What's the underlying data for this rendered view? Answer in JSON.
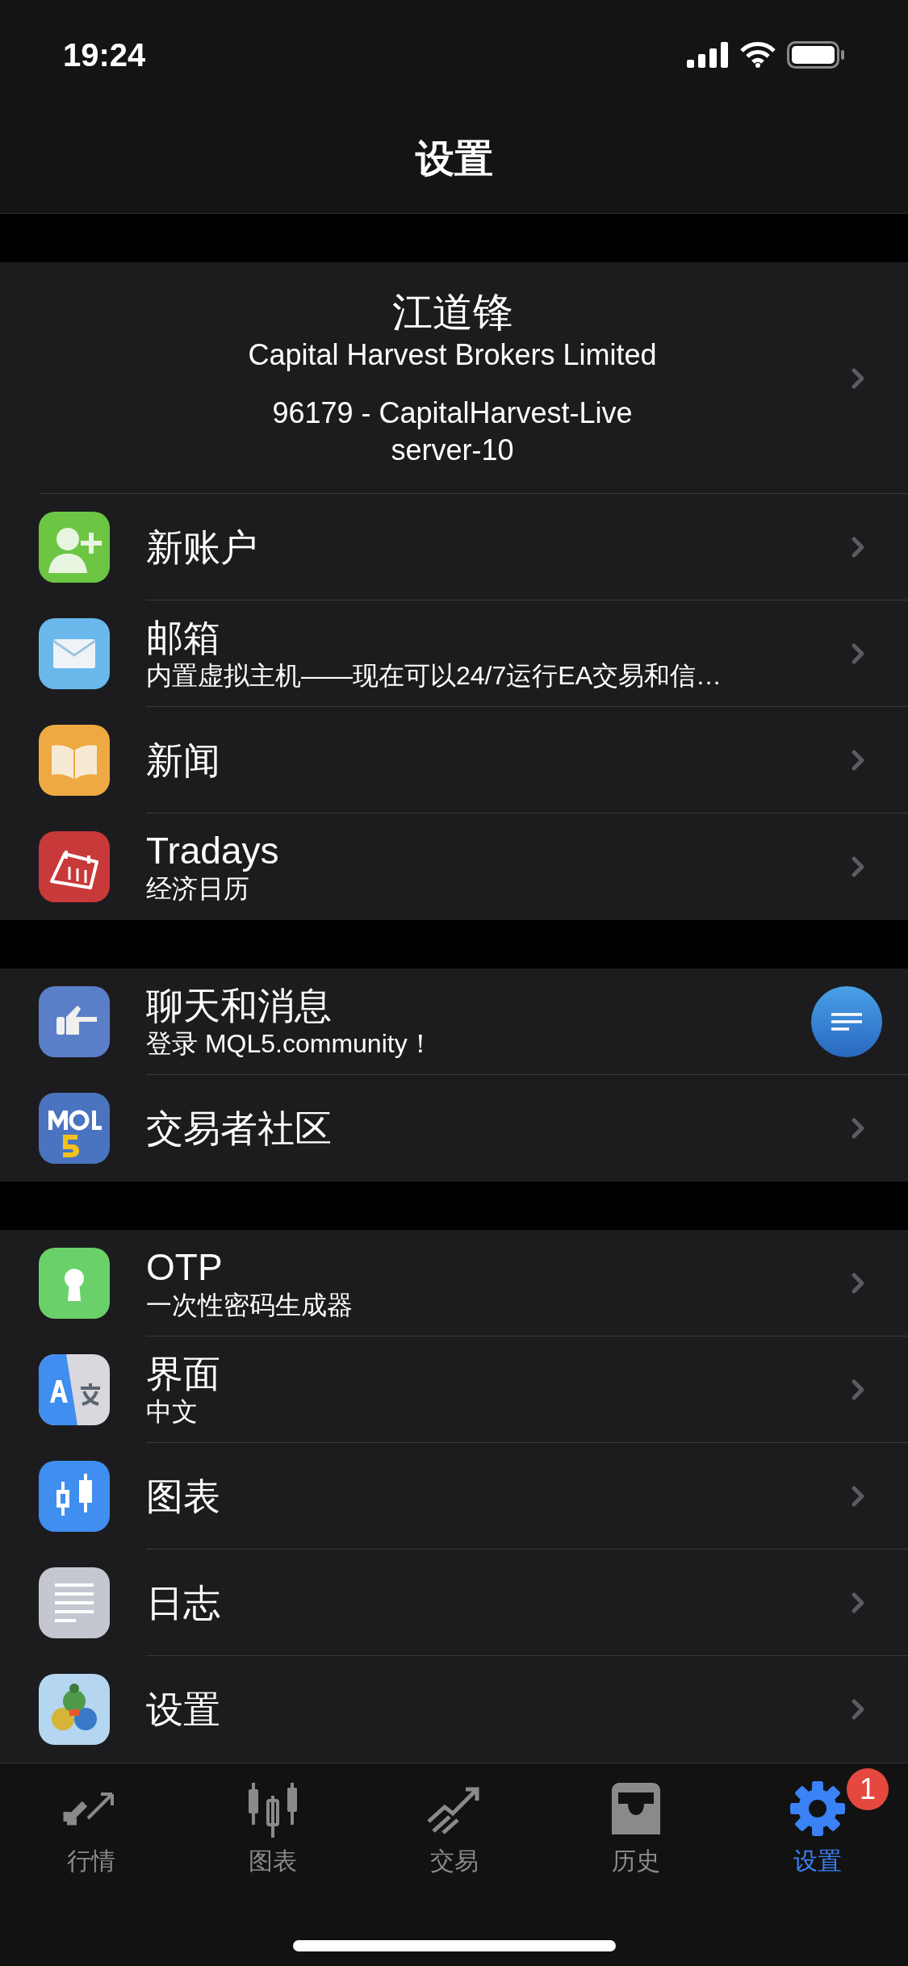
{
  "status_bar": {
    "time": "19:24"
  },
  "nav": {
    "title": "设置"
  },
  "account": {
    "name": "江道锋",
    "company": "Capital Harvest Brokers Limited",
    "login": "96179 - CapitalHarvest-Live",
    "server": "server-10"
  },
  "sections": [
    {
      "items": [
        {
          "kind": "link",
          "title": "新账户"
        },
        {
          "kind": "link",
          "title": "邮箱",
          "subtitle": "内置虚拟主机——现在可以24/7运行EA交易和信…"
        },
        {
          "kind": "link",
          "title": "新闻"
        },
        {
          "kind": "link",
          "title": "Tradays",
          "subtitle": "经济日历"
        }
      ]
    },
    {
      "items": [
        {
          "kind": "chat",
          "title": "聊天和消息",
          "subtitle": "登录 MQL5.community！"
        },
        {
          "kind": "link",
          "title": "交易者社区"
        }
      ]
    },
    {
      "items": [
        {
          "kind": "link",
          "title": "OTP",
          "subtitle": "一次性密码生成器"
        },
        {
          "kind": "link",
          "title": "界面",
          "subtitle": "中文"
        },
        {
          "kind": "link",
          "title": "图表"
        },
        {
          "kind": "link",
          "title": "日志"
        },
        {
          "kind": "link",
          "title": "设置"
        }
      ]
    }
  ],
  "tabs": [
    {
      "label": "行情",
      "selected": false
    },
    {
      "label": "图表",
      "selected": false
    },
    {
      "label": "交易",
      "selected": false
    },
    {
      "label": "历史",
      "selected": false
    },
    {
      "label": "设置",
      "selected": true,
      "badge": "1"
    }
  ]
}
